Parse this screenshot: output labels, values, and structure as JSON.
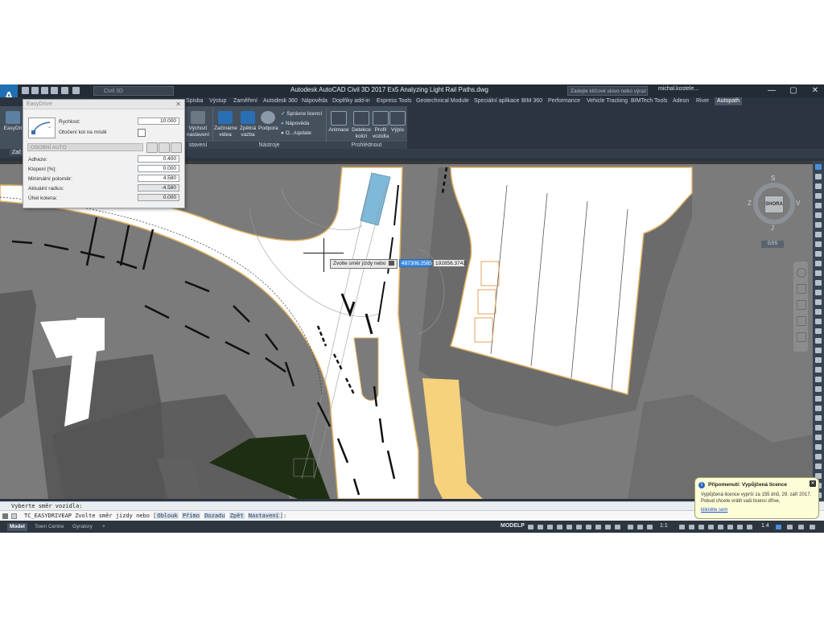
{
  "window": {
    "title": "Autodesk AutoCAD Civil 3D 2017   Ex5 Analyzing Light Rail Paths.dwg",
    "app_button": "A",
    "app_button_sub": "CIV",
    "workspace": "Civil 3D",
    "search_placeholder": "Zadejte klíčové slovo nebo výraz",
    "user": "michal.kostele...",
    "minimize": "—",
    "maximize": "▢",
    "close": "✕"
  },
  "ribbon_tabs": [
    "Spisba",
    "Výstup",
    "Zaměření",
    "Autodesk 360",
    "Nápověda",
    "Doplňky add-in",
    "Express Tools",
    "Geotechnical Module",
    "Speciální aplikace",
    "BIM 360",
    "Performance",
    "Vehicle Tracking",
    "BIMTech Tools",
    "Adeon",
    "River",
    "Autopath"
  ],
  "ribbon_active_tab": "Autopath",
  "ribbon": {
    "easydrive_label": "EasyDri",
    "vychozi_label": "Výchozí nastavení",
    "zaciname_label": "Začínáme videa",
    "zpetna_label": "Zpětná vazba",
    "podpora_label": "Podpora",
    "spravce_label": "Správce licencí",
    "napoveda_label": "Nápověda",
    "update_label": "O.../update",
    "animace_label": "Animace",
    "detekce_label": "Detekce kolizí",
    "profil_label": "Profil vozidla",
    "vypis_label": "Výpis",
    "panel_nastaveni": "stavení",
    "panel_nastroje": "Nástroje",
    "panel_prohlednout": "Prohlédnout"
  },
  "doc_tab": "Zač",
  "easydrive": {
    "title": "EasyDrive",
    "rychlost_label": "Rychlost:",
    "rychlost_value": "10.000",
    "otoceni_label": "Otočení kol na místě",
    "vehicle": "OSOBNÍ AUTO",
    "adheze_label": "Adheze:",
    "adheze_value": "0.400",
    "klopeni_label": "Klopení [%]:",
    "klopeni_value": "0.000",
    "minpolomer_label": "Minimální poloměr:",
    "minpolomer_value": "4.580",
    "aktradius_label": "Aktuální radius:",
    "aktradius_value": "-4.580",
    "uhel_label": "Úhel kolena:",
    "uhel_value": "0.000"
  },
  "dynamic_input": {
    "prompt": "Zvolte směr jízdy nebo",
    "x_value": "487306.2585",
    "y_value": "192856.3742"
  },
  "viewcube": {
    "n": "S",
    "s": "J",
    "e": "V",
    "w": "Z",
    "face": "SHORA",
    "ucs": "GSS"
  },
  "command": {
    "history": "Vyberte směr vozidla:",
    "prompt": "TC_EASYDRIVEAP Zvolte směr jízdy nebo [",
    "options": [
      "Oblouk",
      "Přímo",
      "Dozadu",
      "Zpět",
      "Nastavení"
    ],
    "suffix": "]:"
  },
  "layout_tabs": [
    "Model",
    "Town Centre",
    "Gyratory",
    "+"
  ],
  "status": {
    "modelp": "MODELP",
    "scale": "1:1",
    "scale2": "1.4"
  },
  "balloon": {
    "title": "Připomenutí: Vypůjčená licence",
    "body": "Vypůjčená licence vyprší za 155 dnů, 29. září 2017. Pokud chcete vrátit vaši licenci dříve,",
    "link": "klikněte sem"
  },
  "colors": {
    "accent": "#1f6fb5",
    "road": "#ffffff",
    "pavement": "#7a7a7a",
    "building": "#5a5a5a",
    "yellow_path": "#f7d47f",
    "vehicle": "#7fb9d9",
    "parking_outline": "#e08a30"
  }
}
